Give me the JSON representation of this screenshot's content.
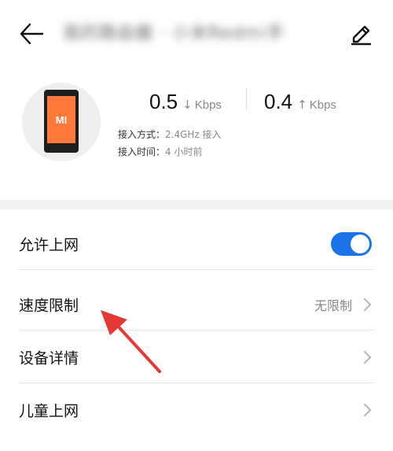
{
  "header": {
    "title": "我的路由器 · 小米Redmi手机"
  },
  "device": {
    "download": {
      "value": "0.5",
      "arrow": "↓",
      "unit": "Kbps"
    },
    "upload": {
      "value": "0.4",
      "arrow": "↑",
      "unit": "Kbps"
    },
    "access_mode_label": "接入方式：",
    "access_mode_value": "2.4GHz 接入",
    "access_time_label": "接入时间：",
    "access_time_value": "4 小时前",
    "brand": "MI"
  },
  "settings": {
    "allow_internet": {
      "label": "允许上网",
      "enabled": true
    },
    "speed_limit": {
      "label": "速度限制",
      "value": "无限制"
    },
    "device_details": {
      "label": "设备详情"
    },
    "kids_internet": {
      "label": "儿童上网"
    }
  },
  "colors": {
    "accent": "#1a73e8",
    "annotation_arrow": "#e53935",
    "phone_screen": "#ff7a3a"
  }
}
